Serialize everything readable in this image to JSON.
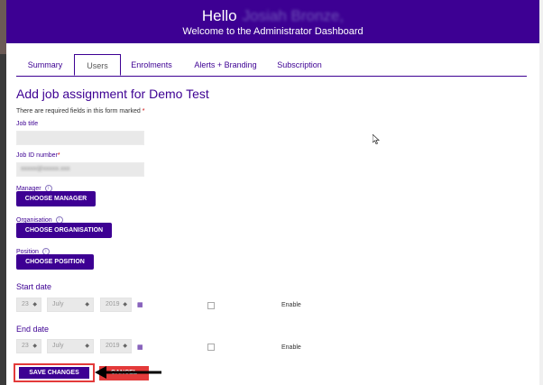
{
  "header": {
    "hello": "Hello",
    "user_name": "Josiah Bronze,",
    "welcome": "Welcome to the Administrator Dashboard"
  },
  "tabs": [
    {
      "label": "Summary",
      "active": false
    },
    {
      "label": "Users",
      "active": true
    },
    {
      "label": "Enrolments",
      "active": false
    },
    {
      "label": "Alerts + Branding",
      "active": false
    },
    {
      "label": "Subscription",
      "active": false
    }
  ],
  "form": {
    "title": "Add job assignment for Demo Test",
    "required_note": "There are required fields in this form marked",
    "required_star": "*",
    "job_title_label": "Job title",
    "job_title_value": "",
    "job_id_label": "Job ID number",
    "job_id_value": "xxxxx@xxxxx.xxx",
    "manager_label": "Manager",
    "choose_manager": "CHOOSE MANAGER",
    "organisation_label": "Organisation",
    "choose_organisation": "CHOOSE ORGANISATION",
    "position_label": "Position",
    "choose_position": "CHOOSE POSITION",
    "start_date_label": "Start date",
    "end_date_label": "End date",
    "start": {
      "day": "23",
      "month": "July",
      "year": "2019",
      "enable": "Enable"
    },
    "end": {
      "day": "23",
      "month": "July",
      "year": "2019",
      "enable": "Enable"
    },
    "save": "SAVE CHANGES",
    "cancel": "CANCEL"
  },
  "colors": {
    "brand": "#3d0093",
    "highlight": "#e33a3a"
  }
}
